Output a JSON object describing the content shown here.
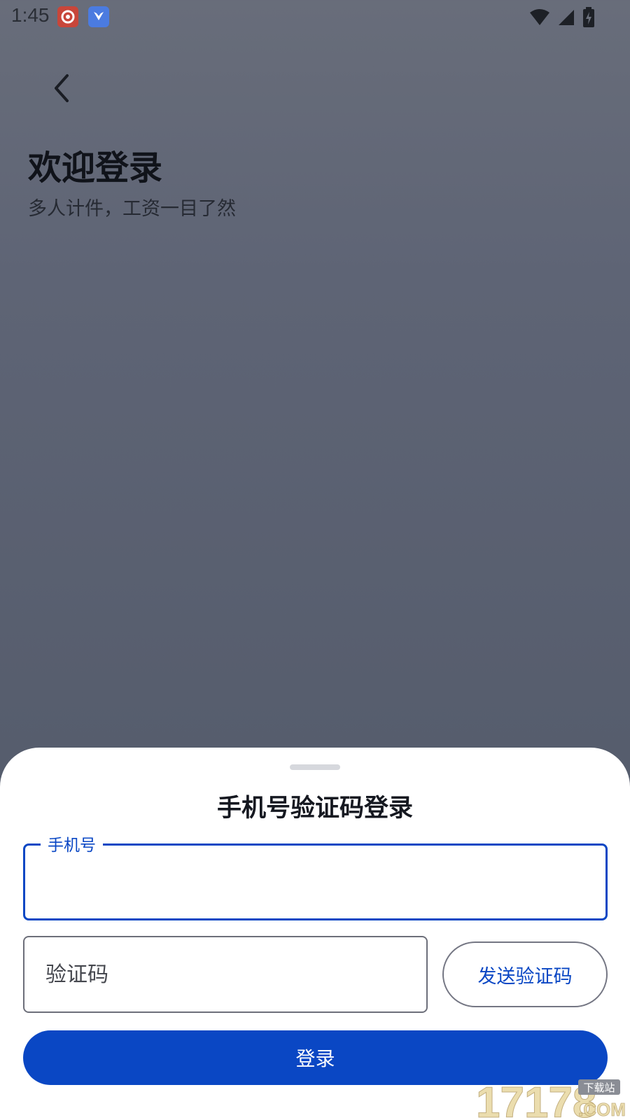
{
  "status_bar": {
    "time": "1:45"
  },
  "header": {
    "title": "欢迎登录",
    "subtitle": "多人计件，工资一目了然"
  },
  "sheet": {
    "title": "手机号验证码登录",
    "phone": {
      "label": "手机号",
      "value": ""
    },
    "code": {
      "placeholder": "验证码",
      "value": ""
    },
    "send_code_label": "发送验证码",
    "login_label": "登录"
  },
  "watermark": {
    "main": "17178",
    "sub": "下载站",
    "suffix": ".COM"
  },
  "colors": {
    "accent": "#0a47c4",
    "backdrop": "#5b6171",
    "sheet": "#ffffff"
  }
}
